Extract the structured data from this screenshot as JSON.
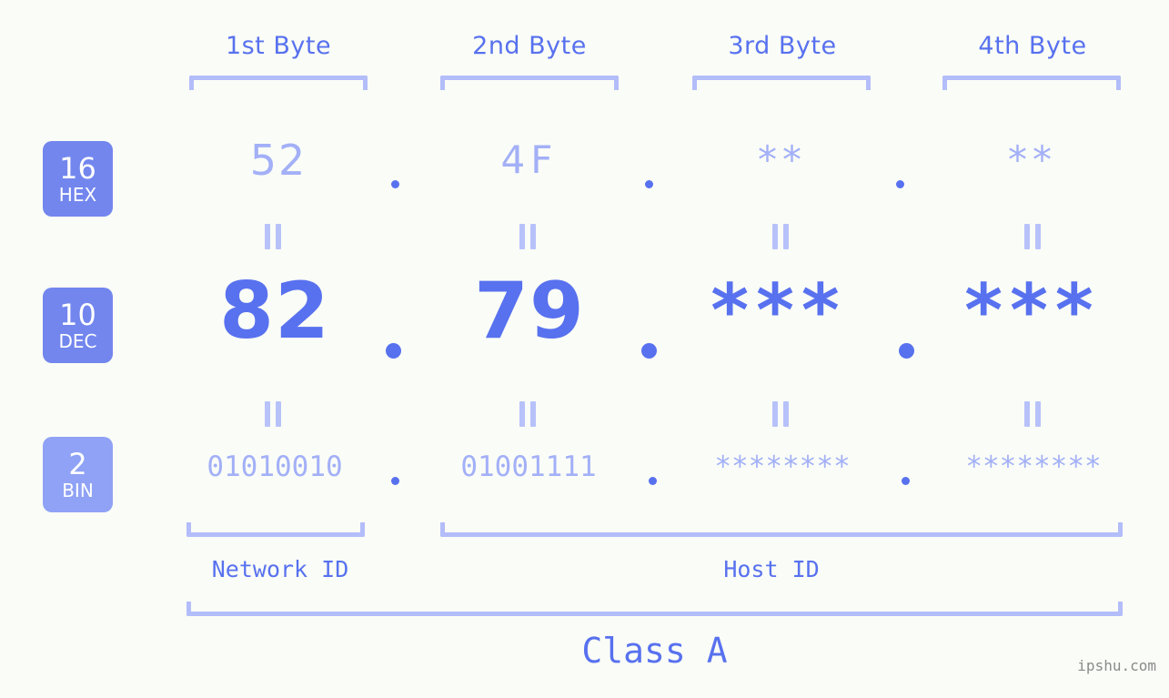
{
  "meta": {
    "background_color": "#fafdf7",
    "accent_color": "#5871ef",
    "muted_accent_color": "#a3b0f7",
    "bracket_color": "#b3bdfa",
    "badge_color": "#7286ee",
    "badge_color_light": "#8fa2f5",
    "watermark": "ipshu.com"
  },
  "byte_headers": [
    {
      "label": "1st Byte"
    },
    {
      "label": "2nd Byte"
    },
    {
      "label": "3rd Byte"
    },
    {
      "label": "4th Byte"
    }
  ],
  "bases": [
    {
      "number": "16",
      "name": "HEX"
    },
    {
      "number": "10",
      "name": "DEC"
    },
    {
      "number": "2",
      "name": "BIN"
    }
  ],
  "rows": {
    "hex": {
      "base_number": "16",
      "base_name": "HEX",
      "values": [
        "52",
        "4F",
        "**",
        "**"
      ],
      "separator": "."
    },
    "dec": {
      "base_number": "10",
      "base_name": "DEC",
      "values": [
        "82",
        "79",
        "***",
        "***"
      ],
      "separator": "."
    },
    "bin": {
      "base_number": "2",
      "base_name": "BIN",
      "values": [
        "01010010",
        "01001111",
        "********",
        "********"
      ],
      "separator": "."
    }
  },
  "segments": {
    "network_id": "Network ID",
    "host_id": "Host ID",
    "class": "Class A"
  }
}
